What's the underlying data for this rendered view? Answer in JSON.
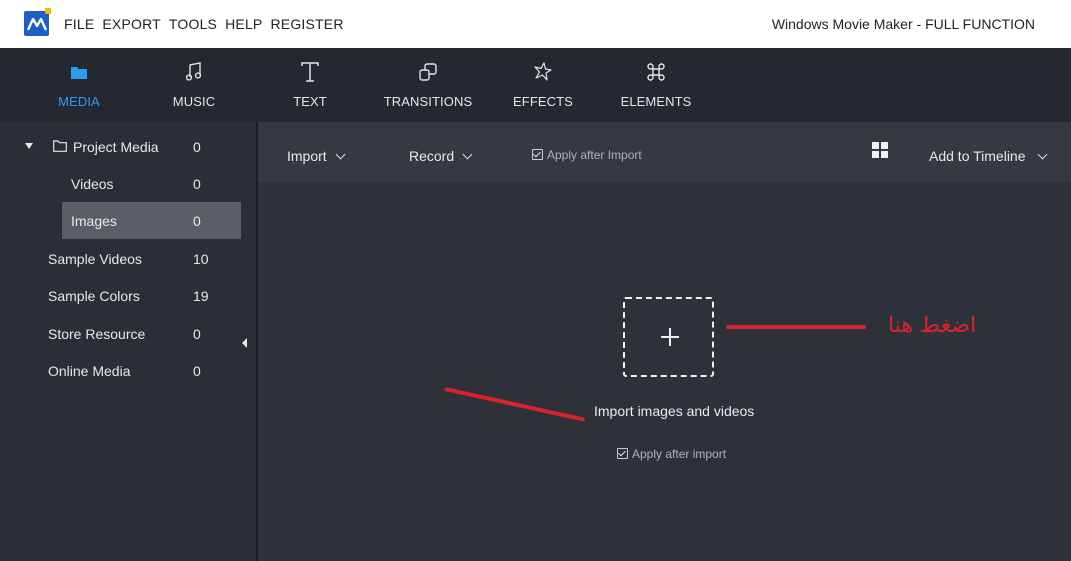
{
  "menubar": {
    "items": [
      "FILE",
      "EXPORT",
      "TOOLS",
      "HELP",
      "REGISTER"
    ],
    "app_title": "Windows Movie Maker - FULL FUNCTION"
  },
  "toolbar": {
    "tools": [
      {
        "label": "MEDIA",
        "icon": "folder-icon",
        "active": true
      },
      {
        "label": "MUSIC",
        "icon": "music-note-icon"
      },
      {
        "label": "TEXT",
        "icon": "text-t-icon"
      },
      {
        "label": "TRANSITIONS",
        "icon": "transitions-icon"
      },
      {
        "label": "EFFECTS",
        "icon": "sparkle-icon"
      },
      {
        "label": "ELEMENTS",
        "icon": "command-icon"
      }
    ],
    "accent_color": "#2f9bf0"
  },
  "sidebar": {
    "items": [
      {
        "label": "Project Media",
        "count": "0",
        "expanded": true
      },
      {
        "label": "Videos",
        "count": "0"
      },
      {
        "label": "Images",
        "count": "0",
        "selected": true
      },
      {
        "label": "Sample Videos",
        "count": "10"
      },
      {
        "label": "Sample Colors",
        "count": "19"
      },
      {
        "label": "Store Resource",
        "count": "0"
      },
      {
        "label": "Online Media",
        "count": "0"
      }
    ]
  },
  "subbar": {
    "import_label": "Import",
    "record_label": "Record",
    "apply_after_import_label": "Apply after Import",
    "add_to_timeline_label": "Add to Timeline"
  },
  "dropzone": {
    "prompt": "Import images and videos",
    "apply_label": "Apply after import"
  },
  "annotation": {
    "text": "اضغط هنا",
    "color": "#d8232a"
  }
}
